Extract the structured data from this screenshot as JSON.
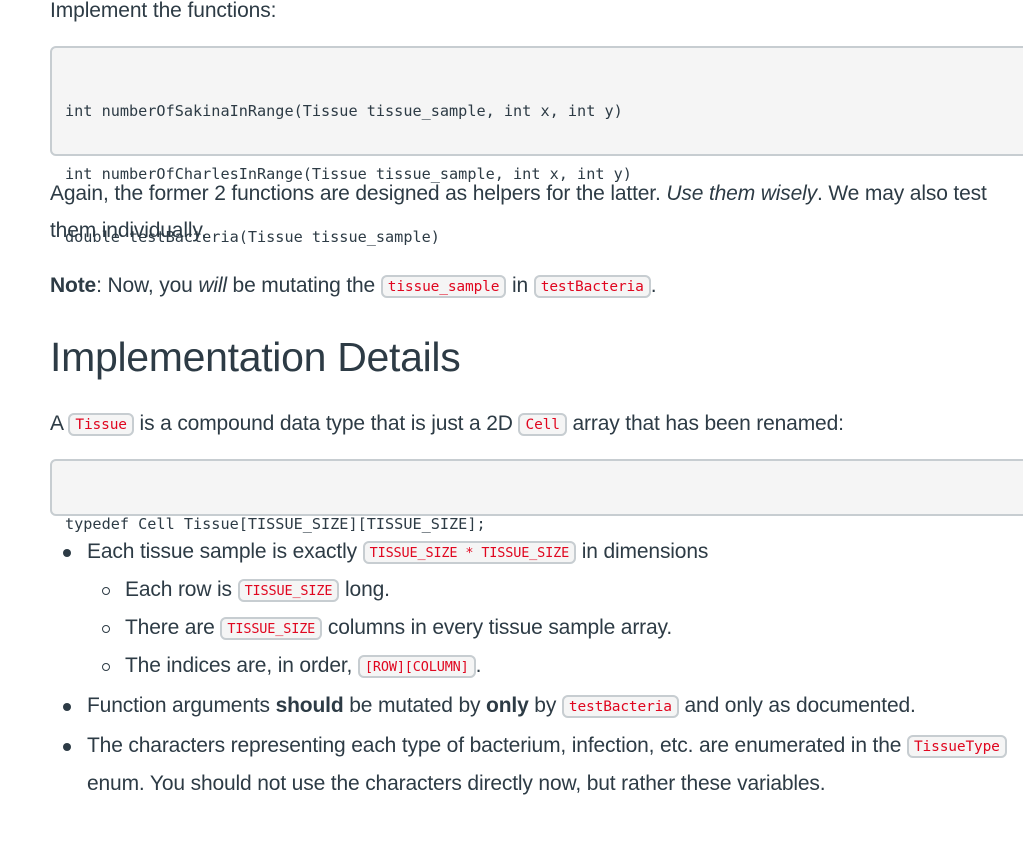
{
  "intro": "Implement the functions:",
  "code_functions": [
    "int numberOfSakinaInRange(Tissue tissue_sample, int x, int y)",
    "int numberOfCharlesInRange(Tissue tissue_sample, int x, int y)",
    "double testBacteria(Tissue tissue_sample)"
  ],
  "para1": {
    "text_a": "Again, the former 2 functions are designed as helpers for the latter. ",
    "emphasis": "Use them wisely",
    "text_b": ". We may also test them individually."
  },
  "para2": {
    "bold": "Note",
    "text_a": ": Now, you ",
    "emphasis": "will",
    "text_b": " be mutating the ",
    "code_a": "tissue_sample",
    "text_c": " in ",
    "code_b": "testBacteria",
    "text_d": "."
  },
  "heading": "Implementation Details",
  "para3": {
    "text_a": "A ",
    "code_a": "Tissue",
    "text_b": " is a compound data type that is just a 2D ",
    "code_b": "Cell",
    "text_c": " array that has been renamed:"
  },
  "code_typedef": "typedef Cell Tissue[TISSUE_SIZE][TISSUE_SIZE];",
  "bullets": {
    "b1": {
      "text_a": "Each tissue sample is exactly ",
      "code": "TISSUE_SIZE * TISSUE_SIZE",
      "text_b": " in dimensions",
      "sub": [
        {
          "text_a": "Each row is ",
          "code": "TISSUE_SIZE",
          "text_b": " long."
        },
        {
          "text_a": "There are ",
          "code": "TISSUE_SIZE",
          "text_b": " columns in every tissue sample array."
        },
        {
          "text_a": "The indices are, in order, ",
          "code": "[ROW][COLUMN]",
          "text_b": "."
        }
      ]
    },
    "b2": {
      "text_a": "Function arguments ",
      "bold_a": "should",
      "text_b": " be mutated by ",
      "bold_b": "only",
      "text_c": " by ",
      "code": "testBacteria",
      "text_d": " and only as documented."
    },
    "b3": {
      "text_a": "The characters representing each type of bacterium, infection, etc. are enumerated in the ",
      "code": "TissueType",
      "text_b": " enum. You should not use the characters directly now, but rather these variables."
    }
  }
}
